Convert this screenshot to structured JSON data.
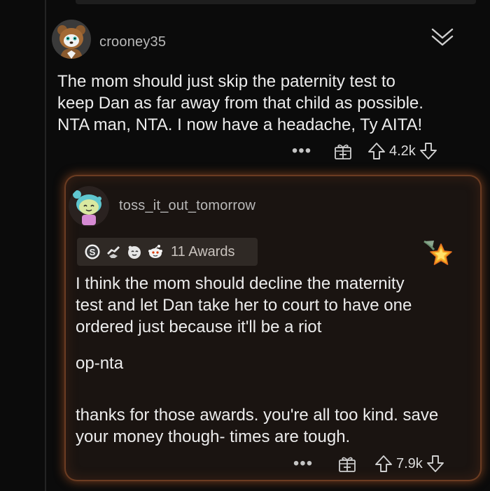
{
  "top_comment": {
    "username": "crooney35",
    "body": "The mom should just skip the paternity test to\nkeep Dan as far away from that child as possible.\nNTA man, NTA. I now have a headache, Ty AITA!",
    "score": "4.2k",
    "more_label": "•••"
  },
  "reply": {
    "username": "toss_it_out_tomorrow",
    "awards_label": "11 Awards",
    "body_p1": "I think the mom should decline the maternity\ntest and let Dan take her to court to have one\nordered just because it'll be a riot",
    "body_p2": "op-nta",
    "body_p3": "thanks for those awards. you're all too kind. save\nyour money though- times are tough.",
    "score": "7.9k",
    "more_label": "•••"
  },
  "colors": {
    "background": "#0b0b0b",
    "card_glow": "#c4622c",
    "award_star": "#f4b227"
  },
  "icons": [
    "collapse-chevrons-icon",
    "gift-award-icon",
    "upvote-icon",
    "downvote-icon",
    "silver-award-icon",
    "helpful-award-icon",
    "wholesome-award-icon",
    "snoo-award-icon",
    "star-award-icon"
  ]
}
